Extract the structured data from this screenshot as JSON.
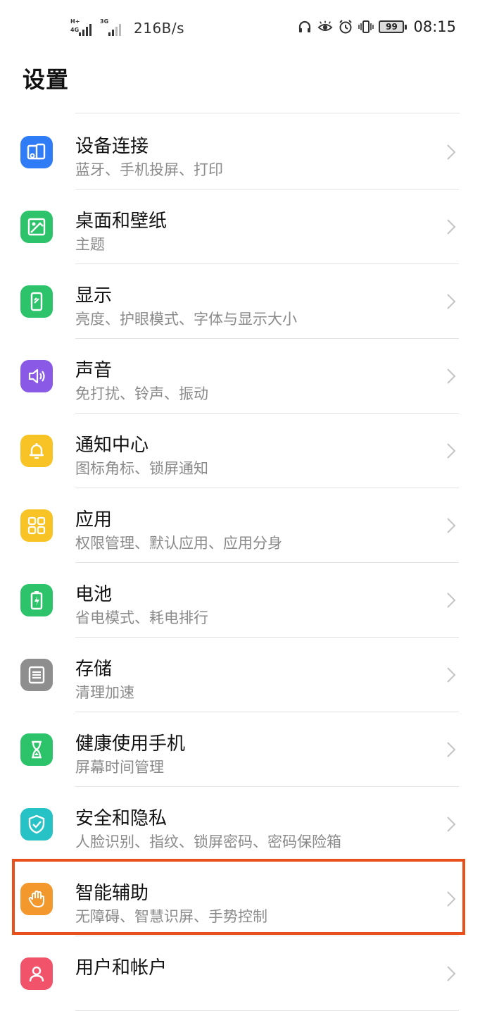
{
  "status_bar": {
    "net1_top": "H+",
    "net1_bottom": "4G",
    "net2_top": "3G",
    "net_speed": "216B/s",
    "battery": "99",
    "time": "08:15"
  },
  "page": {
    "title": "设置"
  },
  "items": [
    {
      "title": "设备连接",
      "subtitle": "蓝牙、手机投屏、打印",
      "icon": "device-connection-icon",
      "color": "#2f7cf6"
    },
    {
      "title": "桌面和壁纸",
      "subtitle": "主题",
      "icon": "wallpaper-icon",
      "color": "#2cc36b"
    },
    {
      "title": "显示",
      "subtitle": "亮度、护眼模式、字体与显示大小",
      "icon": "display-icon",
      "color": "#2cc36b"
    },
    {
      "title": "声音",
      "subtitle": "免打扰、铃声、振动",
      "icon": "sound-icon",
      "color": "#8a5ae6"
    },
    {
      "title": "通知中心",
      "subtitle": "图标角标、锁屏通知",
      "icon": "bell-icon",
      "color": "#f7c325"
    },
    {
      "title": "应用",
      "subtitle": "权限管理、默认应用、应用分身",
      "icon": "apps-icon",
      "color": "#f7c325"
    },
    {
      "title": "电池",
      "subtitle": "省电模式、耗电排行",
      "icon": "battery-icon",
      "color": "#2cc36b"
    },
    {
      "title": "存储",
      "subtitle": "清理加速",
      "icon": "storage-icon",
      "color": "#8e8e8e"
    },
    {
      "title": "健康使用手机",
      "subtitle": "屏幕时间管理",
      "icon": "hourglass-icon",
      "color": "#2cc36b"
    },
    {
      "title": "安全和隐私",
      "subtitle": "人脸识别、指纹、锁屏密码、密码保险箱",
      "icon": "shield-icon",
      "color": "#26c2c5"
    },
    {
      "title": "智能辅助",
      "subtitle": "无障碍、智慧识屏、手势控制",
      "icon": "hand-icon",
      "color": "#f3982d"
    },
    {
      "title": "用户和帐户",
      "subtitle": "",
      "icon": "user-icon",
      "color": "#f0536a"
    }
  ],
  "highlight_color": "#e8501c"
}
